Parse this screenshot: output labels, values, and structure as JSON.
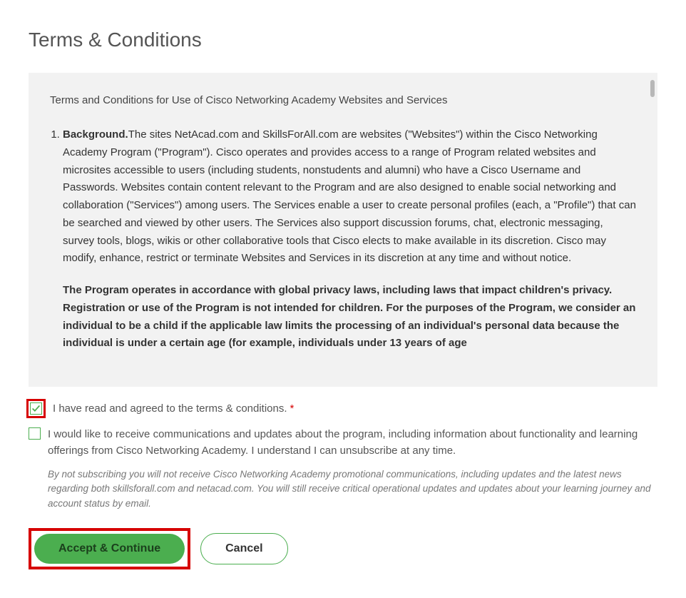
{
  "page": {
    "title": "Terms & Conditions"
  },
  "terms": {
    "intro": "Terms and Conditions for Use of Cisco Networking Academy Websites and Services",
    "items": [
      {
        "heading": "Background.",
        "body": "The sites NetAcad.com and SkillsForAll.com are websites (\"Websites\") within the Cisco Networking Academy Program (\"Program\"). Cisco operates and provides access to a range of Program related websites and microsites accessible to users (including students, nonstudents and alumni) who have a Cisco Username and Passwords. Websites contain content relevant to the Program and are also designed to enable social networking and collaboration (\"Services\") among users. The Services enable a user to create personal profiles (each, a \"Profile\") that can be searched and viewed by other users. The Services also support discussion forums, chat, electronic messaging, survey tools, blogs, wikis or other collaborative tools that Cisco elects to make available in its discretion. Cisco may modify, enhance, restrict or terminate Websites and Services in its discretion at any time and without notice.",
        "boldPara": "The Program operates in accordance with global privacy laws, including laws that impact children's privacy. Registration or use of the Program is not intended for children. For the purposes of the Program, we consider an individual to be a child if the applicable law limits the processing of an individual's personal data because the individual is under a certain age (for example, individuals under 13 years of age"
      }
    ]
  },
  "checkboxes": {
    "agree": {
      "label": "I have read and agreed to the terms & conditions.",
      "required": "*",
      "checked": true
    },
    "subscribe": {
      "label": "I would like to receive communications and updates about the program, including information about functionality and learning offerings from Cisco Networking Academy. I understand I can unsubscribe at any time.",
      "checked": false,
      "note": "By not subscribing you will not receive Cisco Networking Academy promotional communications, including updates and the latest news regarding both skillsforall.com and netacad.com. You will still receive critical operational updates and updates about your learning journey and account status by email."
    }
  },
  "buttons": {
    "accept": "Accept & Continue",
    "cancel": "Cancel"
  }
}
